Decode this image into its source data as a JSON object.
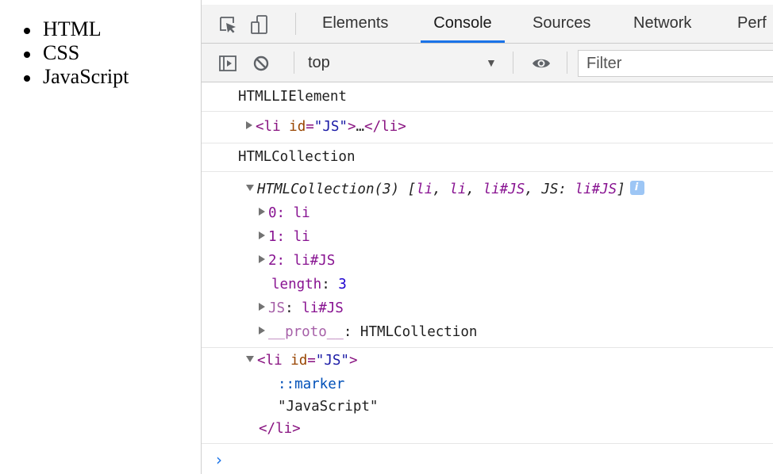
{
  "page": {
    "list_items": [
      "HTML",
      "CSS",
      "JavaScript"
    ]
  },
  "devtools": {
    "tabs": [
      "Elements",
      "Console",
      "Sources",
      "Network",
      "Perf"
    ],
    "active_tab": "Console",
    "context": "top",
    "filter_placeholder": "Filter",
    "accent_color": "#1a73e8"
  },
  "console": {
    "log1": "HTMLLIElement",
    "elem1": {
      "open": "<",
      "tag": "li",
      "attr": "id",
      "eq": "=",
      "val": "\"JS\"",
      "close": ">",
      "ellipsis": "…",
      "end_open": "</",
      "end_tag": "li",
      "end_close": ">"
    },
    "log2": "HTMLCollection",
    "collection": {
      "summary_name": "HTMLCollection(3)",
      "summary_items": "[li, li, li#JS, JS: li#JS]",
      "p_li": "li",
      "p_lijs": "li#JS",
      "p_js": "JS",
      "p_colon": ":",
      "p_open": "[",
      "p_close": "]",
      "p_comma": ",",
      "rows": [
        {
          "key": "0",
          "value": "li"
        },
        {
          "key": "1",
          "value": "li"
        },
        {
          "key": "2",
          "value": "li#JS"
        }
      ],
      "length_key": "length",
      "length_value": "3",
      "js_key": "JS",
      "js_value": "li#JS",
      "proto_key": "__proto__",
      "proto_value": "HTMLCollection"
    },
    "elem2": {
      "open": "<",
      "tag": "li",
      "attr": "id",
      "eq": "=",
      "val": "\"JS\"",
      "close": ">",
      "marker": "::marker",
      "text": "\"JavaScript\"",
      "end": "</li>",
      "end_open": "</",
      "end_tag": "li",
      "end_close": ">"
    },
    "prompt_symbol": "›"
  }
}
